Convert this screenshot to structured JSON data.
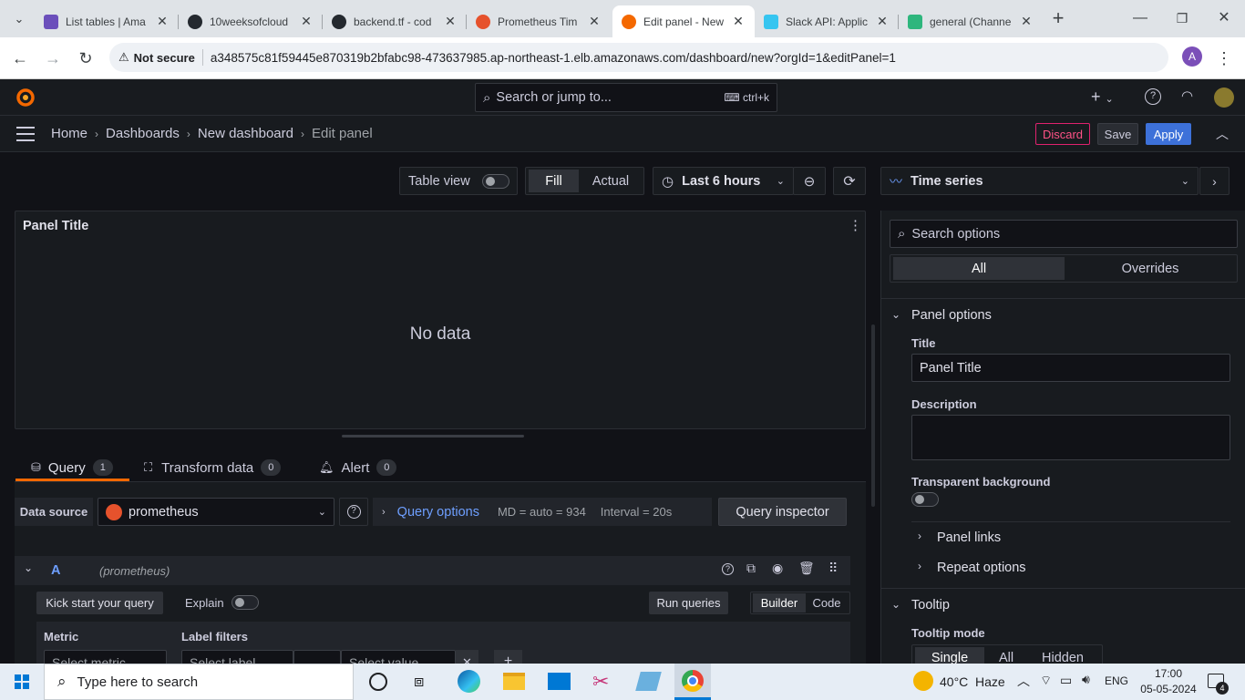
{
  "browser": {
    "tabs": [
      {
        "title": "List tables | Ama",
        "color": "#6b4fbb"
      },
      {
        "title": "10weeksofcloud",
        "color": "#24292f"
      },
      {
        "title": "backend.tf - cod",
        "color": "#24292f"
      },
      {
        "title": "Prometheus Tim",
        "color": "#e6522c"
      },
      {
        "title": "Edit panel - New",
        "color": "#f46800"
      },
      {
        "title": "Slack API: Applic",
        "color": "#36c5f0"
      },
      {
        "title": "general (Channe",
        "color": "#2eb67d"
      }
    ],
    "security_label": "Not secure",
    "url": "a348575c81f59445e870319b2bfabc98-473637985.ap-northeast-1.elb.amazonaws.com/dashboard/new?orgId=1&editPanel=1",
    "profile_initial": "A"
  },
  "grafana": {
    "search_placeholder": "Search or jump to...",
    "search_shortcut": "ctrl+k",
    "breadcrumb": [
      "Home",
      "Dashboards",
      "New dashboard",
      "Edit panel"
    ],
    "discard_label": "Discard",
    "save_label": "Save",
    "apply_label": "Apply",
    "table_view_label": "Table view",
    "fill_label": "Fill",
    "actual_label": "Actual",
    "time_range_label": "Last 6 hours",
    "viz_type": "Time series",
    "panel_title": "Panel Title",
    "no_data": "No data",
    "tabs": {
      "query_label": "Query",
      "query_count": "1",
      "transform_label": "Transform data",
      "transform_count": "0",
      "alert_label": "Alert",
      "alert_count": "0"
    },
    "query": {
      "datasource_label": "Data source",
      "datasource_value": "prometheus",
      "query_options_label": "Query options",
      "md_text": "MD = auto = 934",
      "interval_text": "Interval = 20s",
      "inspector_label": "Query inspector",
      "ref_id": "A",
      "ref_source": "(prometheus)",
      "kickstart_label": "Kick start your query",
      "explain_label": "Explain",
      "run_label": "Run queries",
      "builder_label": "Builder",
      "code_label": "Code",
      "metric_label": "Metric",
      "label_filters_label": "Label filters",
      "metric_placeholder": "Select metric",
      "label_placeholder": "Select label",
      "value_placeholder": "Select value"
    },
    "options": {
      "search_placeholder": "Search options",
      "all_label": "All",
      "overrides_label": "Overrides",
      "panel_options_label": "Panel options",
      "title_label": "Title",
      "title_value": "Panel Title",
      "description_label": "Description",
      "transparent_label": "Transparent background",
      "panel_links_label": "Panel links",
      "repeat_options_label": "Repeat options",
      "tooltip_label": "Tooltip",
      "tooltip_mode_label": "Tooltip mode",
      "tooltip_modes": [
        "Single",
        "All",
        "Hidden"
      ]
    }
  },
  "taskbar": {
    "search_placeholder": "Type here to search",
    "temperature": "40°C",
    "weather": "Haze",
    "language": "ENG",
    "time": "17:00",
    "date": "05-05-2024",
    "notification_count": "4"
  },
  "colors": {
    "accent": "#3d71d9",
    "discard": "#e0226e",
    "grafana_orange": "#f46800"
  }
}
